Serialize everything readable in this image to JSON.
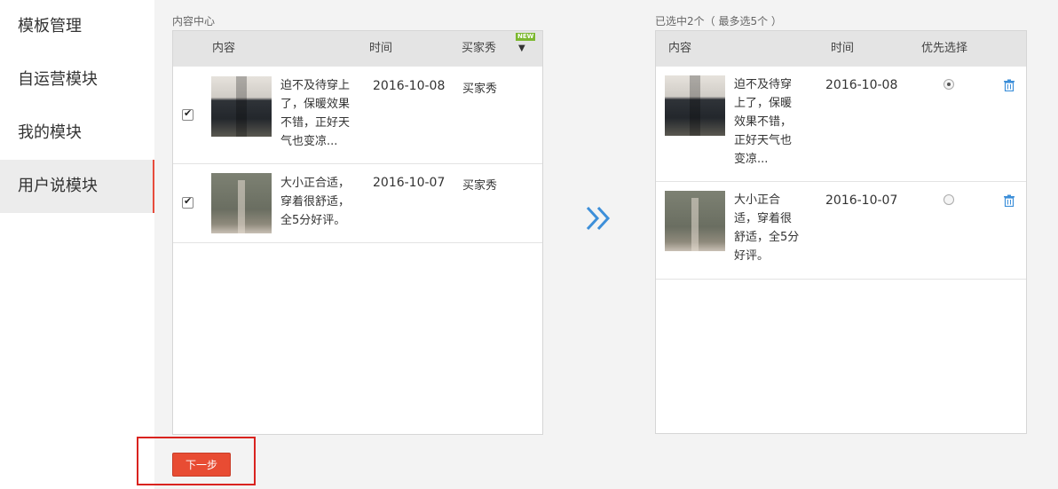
{
  "sidebar": {
    "items": [
      {
        "label": "模板管理"
      },
      {
        "label": "自运营模块"
      },
      {
        "label": "我的模块"
      },
      {
        "label": "用户说模块"
      }
    ]
  },
  "left_panel": {
    "title": "内容中心",
    "headers": {
      "content": "内容",
      "time": "时间",
      "type": "买家秀"
    },
    "new_badge": "NEW",
    "rows": [
      {
        "text": [
          "迫不及待穿上",
          "了，保暖效果",
          "不错，正好天",
          "气也变凉..."
        ],
        "date": "2016-10-08",
        "type": "买家秀",
        "checked": true
      },
      {
        "text": [
          "大小正合适，",
          "穿着很舒适，",
          "全5分好评。"
        ],
        "date": "2016-10-07",
        "type": "买家秀",
        "checked": true
      }
    ]
  },
  "right_panel": {
    "title": "已选中2个（ 最多选5个 ）",
    "headers": {
      "content": "内容",
      "time": "时间",
      "priority": "优先选择"
    },
    "rows": [
      {
        "text": [
          "迫不及待穿",
          "上了，保暖",
          "效果不错，",
          "正好天气也",
          "变凉..."
        ],
        "date": "2016-10-08",
        "priority": true
      },
      {
        "text": [
          "大小正合",
          "适，穿着很",
          "舒适，全5分",
          "好评。"
        ],
        "date": "2016-10-07",
        "priority": false
      }
    ]
  },
  "actions": {
    "next_label": "下一步"
  },
  "colors": {
    "accent": "#e84c33",
    "highlight_box": "#d9231f",
    "arrow": "#3d8fd9",
    "active_border": "#e74c3c"
  }
}
